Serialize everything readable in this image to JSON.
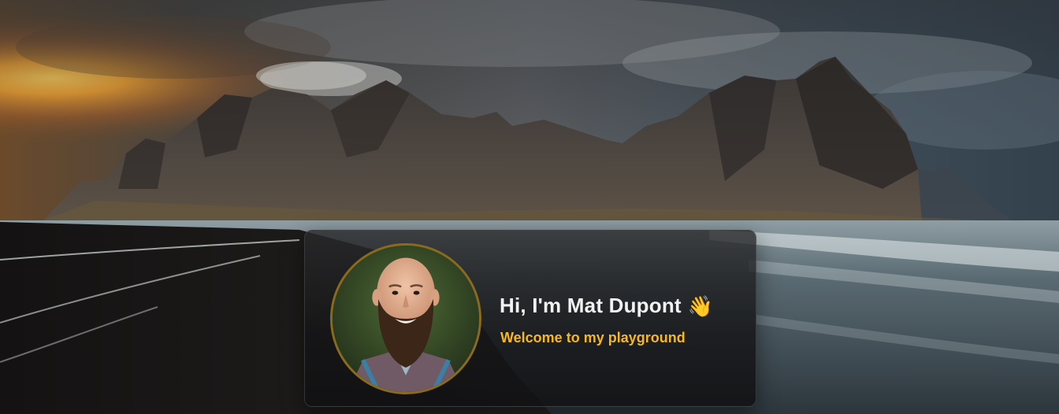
{
  "hero": {
    "background": {
      "icon": "mountain-beach-landscape",
      "sky_color": "#3a434c",
      "sunset_color": "#f0a030"
    }
  },
  "profile_card": {
    "avatar_icon": "bearded-man-portrait",
    "avatar_ring_color": "#8a6a1e",
    "greeting": "Hi, I'm Mat Dupont",
    "wave_emoji": "👋",
    "tagline": "Welcome to my playground",
    "tagline_color": "#f5b820"
  }
}
